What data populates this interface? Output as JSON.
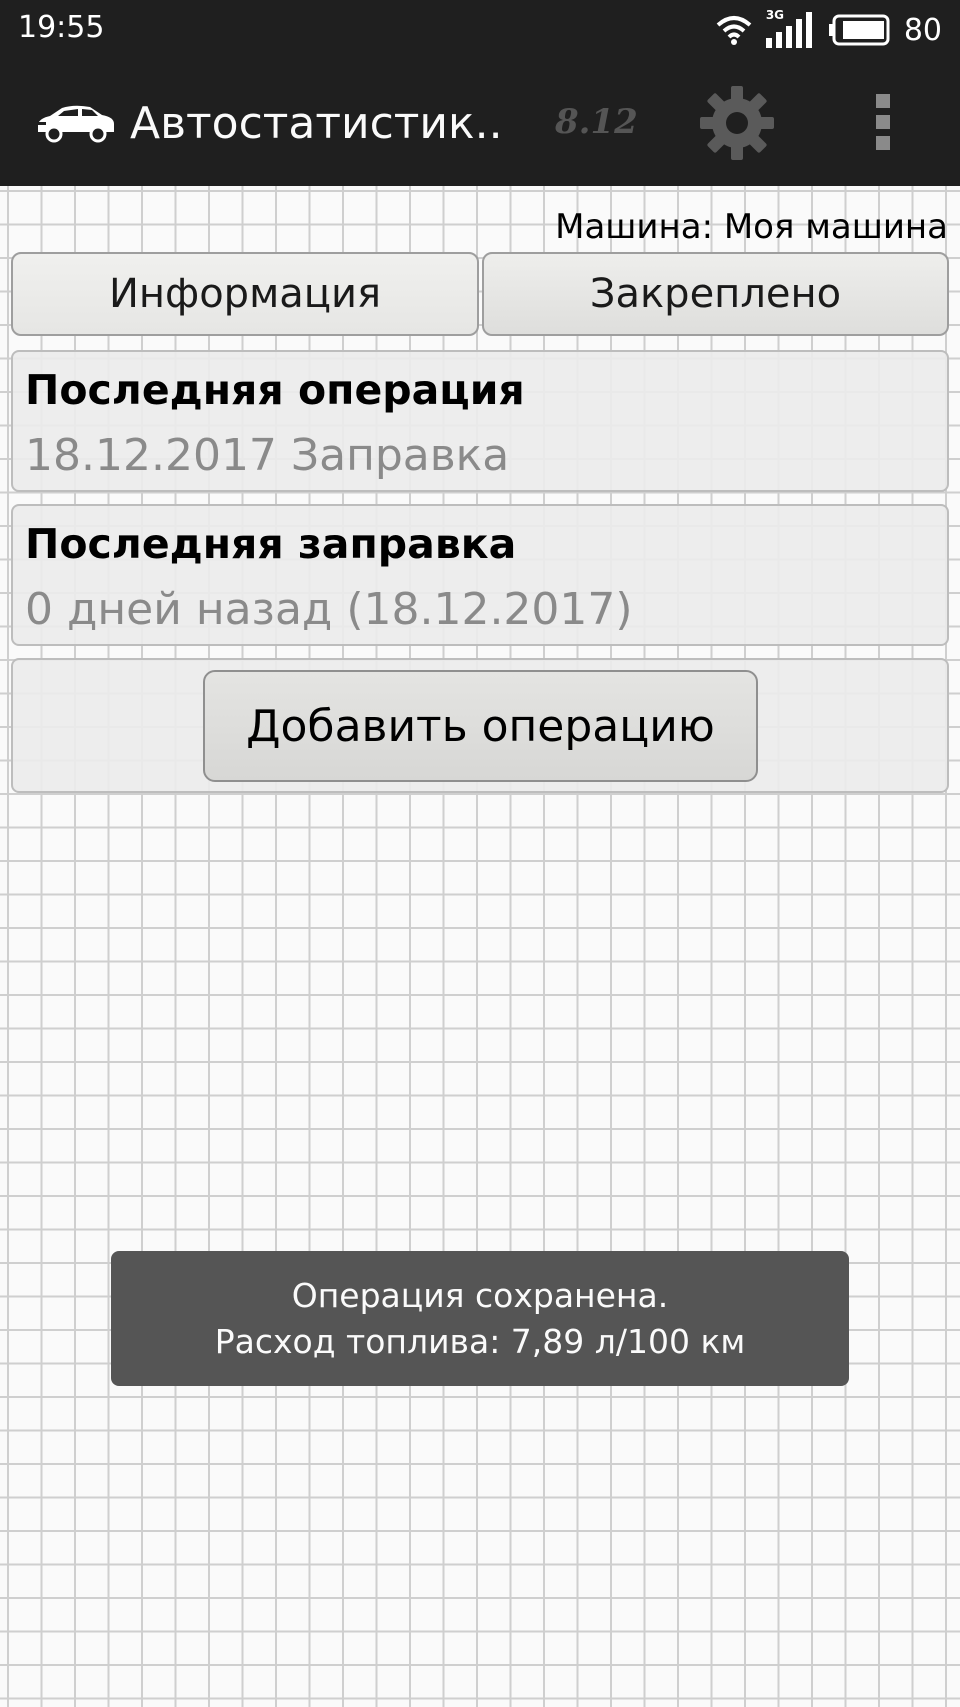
{
  "status_bar": {
    "time": "19:55",
    "network_type": "3G",
    "battery_level": "80",
    "icons": [
      "wifi-icon",
      "signal-icon",
      "battery-icon"
    ]
  },
  "action_bar": {
    "logo_icon": "car-icon",
    "title": "Автостатистик..",
    "version_badge": "8.12",
    "settings_icon": "gear-icon",
    "overflow_icon": "overflow-menu-icon"
  },
  "car": {
    "line": "Машина: Моя машина"
  },
  "tabs": [
    {
      "label": "Информация"
    },
    {
      "label": "Закреплено"
    }
  ],
  "cards": {
    "last_operation": {
      "title": "Последняя операция",
      "value": "18.12.2017 Заправка"
    },
    "last_refuel": {
      "title": "Последняя заправка",
      "value": "0 дней назад (18.12.2017)"
    }
  },
  "add_operation_button": {
    "label": "Добавить операцию"
  },
  "toast": {
    "line1": "Операция сохранена.",
    "line2": "Расход топлива: 7,89 л/100 км"
  },
  "colors": {
    "bar_background": "#1f1f1f",
    "toast_background": "#555555",
    "grid_line": "#cfcfcf"
  }
}
